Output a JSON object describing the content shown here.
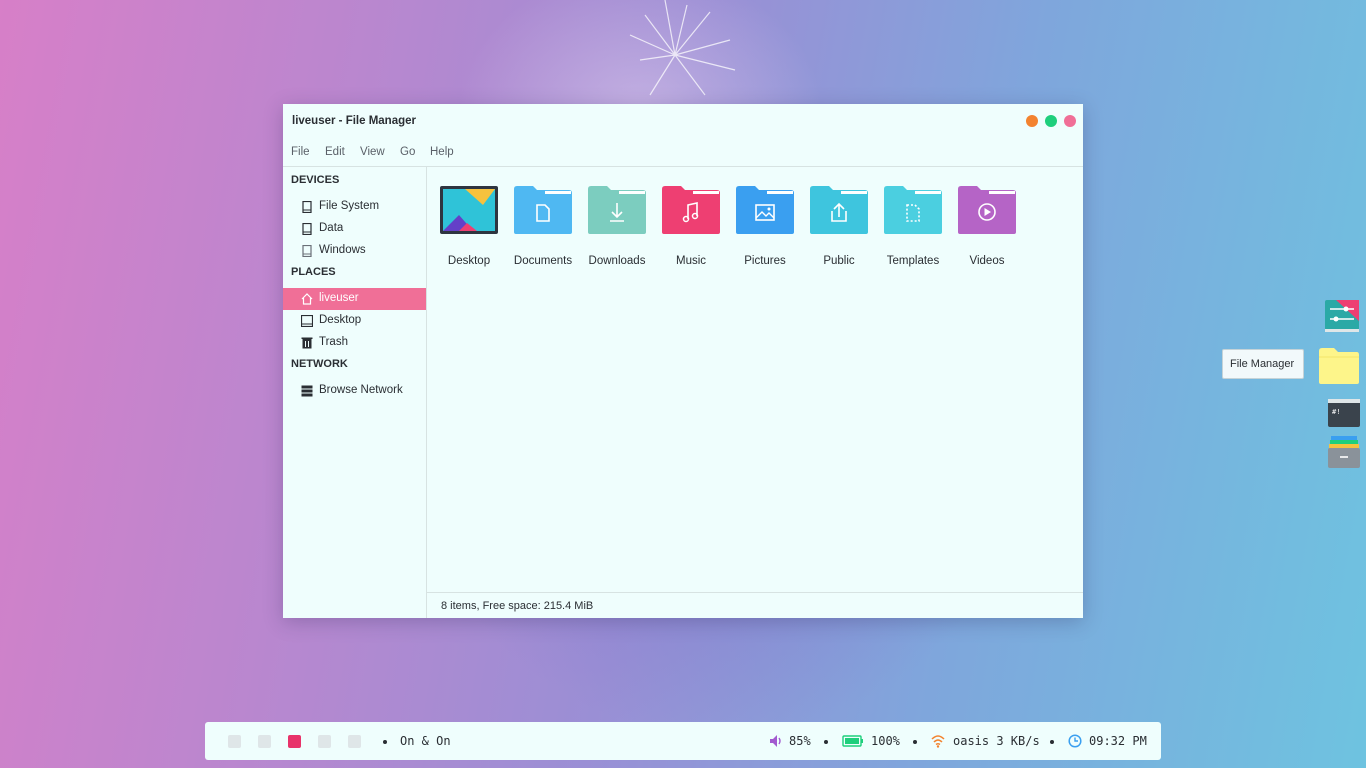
{
  "window": {
    "title": "liveuser - File Manager",
    "controls": {
      "minimize_color": "#f3832f",
      "maximize_color": "#1ecf7c",
      "close_color": "#f06f97"
    }
  },
  "menubar": [
    "File",
    "Edit",
    "View",
    "Go",
    "Help"
  ],
  "sidebar": {
    "devices_header": "DEVICES",
    "devices": [
      {
        "label": "File System",
        "icon": "drive-icon"
      },
      {
        "label": "Data",
        "icon": "drive-icon"
      },
      {
        "label": "Windows",
        "icon": "drive-icon"
      }
    ],
    "places_header": "PLACES",
    "places": [
      {
        "label": "liveuser",
        "icon": "home-icon",
        "active": true
      },
      {
        "label": "Desktop",
        "icon": "desktop-icon"
      },
      {
        "label": "Trash",
        "icon": "trash-icon"
      }
    ],
    "network_header": "NETWORK",
    "network": [
      {
        "label": "Browse Network",
        "icon": "network-icon"
      }
    ]
  },
  "files": [
    {
      "label": "Desktop",
      "icon": "desktop-folder-icon"
    },
    {
      "label": "Documents",
      "icon": "documents-folder-icon",
      "color": "#4fb8f2"
    },
    {
      "label": "Downloads",
      "icon": "downloads-folder-icon",
      "color": "#7ccdbf"
    },
    {
      "label": "Music",
      "icon": "music-folder-icon",
      "color": "#ee3f72"
    },
    {
      "label": "Pictures",
      "icon": "pictures-folder-icon",
      "color": "#3a9ff0"
    },
    {
      "label": "Public",
      "icon": "public-folder-icon",
      "color": "#3ec5de"
    },
    {
      "label": "Templates",
      "icon": "templates-folder-icon",
      "color": "#4bcfe0"
    },
    {
      "label": "Videos",
      "icon": "videos-folder-icon",
      "color": "#b564c6"
    }
  ],
  "statusbar": {
    "text": "8 items, Free space: 215.4 MiB"
  },
  "dock": {
    "tooltip": "File Manager",
    "items": [
      "settings-app-icon",
      "file-manager-app-icon",
      "terminal-app-icon",
      "archive-app-icon"
    ]
  },
  "panel": {
    "workspaces": [
      false,
      false,
      true,
      false,
      false
    ],
    "window_title": "On & On",
    "volume": "85%",
    "battery": "100%",
    "network": "oasis 3 KB/s",
    "clock": "09:32 PM",
    "colors": {
      "accent": "#e8336a",
      "volume": "#a25ad0",
      "battery": "#1ecf7c",
      "wifi": "#f3832f",
      "clock": "#3a9ff0"
    }
  }
}
